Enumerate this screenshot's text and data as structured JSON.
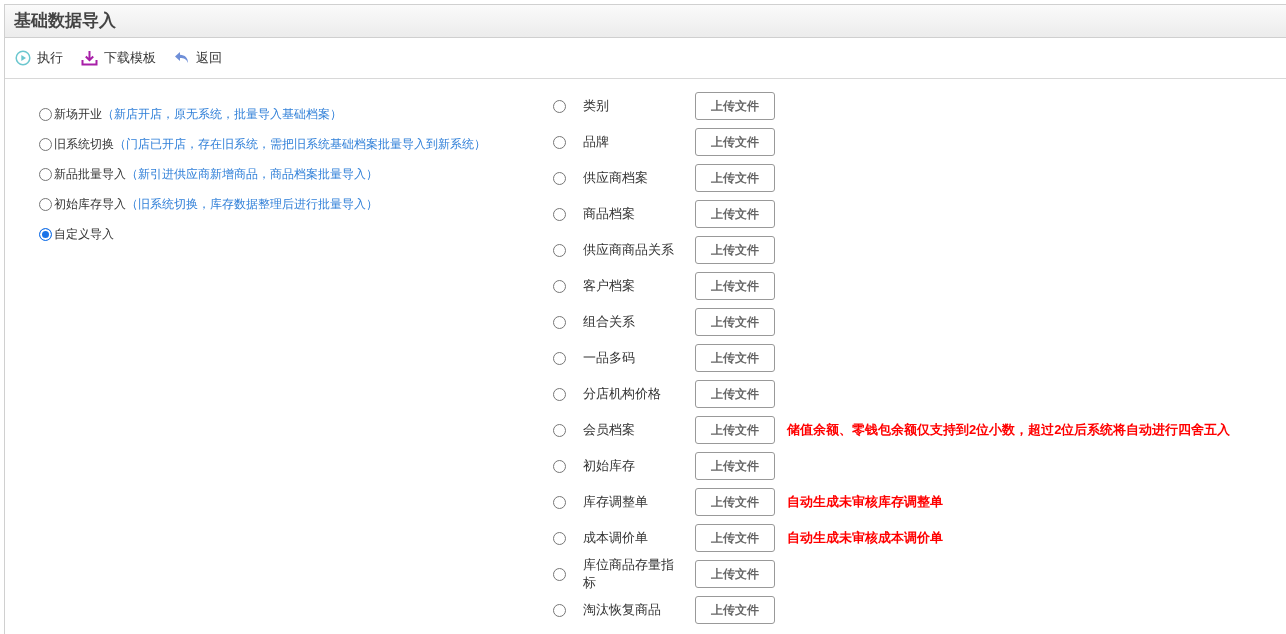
{
  "title": "基础数据导入",
  "toolbar": [
    {
      "kind": "play",
      "label": "执行"
    },
    {
      "kind": "download",
      "label": "下载模板"
    },
    {
      "kind": "back",
      "label": "返回"
    }
  ],
  "modes": [
    {
      "label": "新场开业",
      "note": "（新店开店，原无系统，批量导入基础档案）",
      "selected": false
    },
    {
      "label": "旧系统切换",
      "note": "（门店已开店，存在旧系统，需把旧系统基础档案批量导入到新系统）",
      "selected": false
    },
    {
      "label": "新品批量导入",
      "note": "（新引进供应商新增商品，商品档案批量导入）",
      "selected": false
    },
    {
      "label": "初始库存导入",
      "note": "（旧系统切换，库存数据整理后进行批量导入）",
      "selected": false
    },
    {
      "label": "自定义导入",
      "selected": true
    }
  ],
  "import_items": [
    {
      "label": "类别",
      "selected": false,
      "button": "上传文件"
    },
    {
      "label": "品牌",
      "selected": false,
      "button": "上传文件"
    },
    {
      "label": "供应商档案",
      "selected": false,
      "button": "上传文件"
    },
    {
      "label": "商品档案",
      "selected": false,
      "button": "上传文件"
    },
    {
      "label": "供应商商品关系",
      "selected": false,
      "button": "上传文件"
    },
    {
      "label": "客户档案",
      "selected": false,
      "button": "上传文件"
    },
    {
      "label": "组合关系",
      "selected": false,
      "button": "上传文件"
    },
    {
      "label": "一品多码",
      "selected": false,
      "button": "上传文件"
    },
    {
      "label": "分店机构价格",
      "selected": false,
      "button": "上传文件"
    },
    {
      "label": "会员档案",
      "selected": false,
      "button": "上传文件",
      "note": "储值余额、零钱包余额仅支持到2位小数，超过2位后系统将自动进行四舍五入"
    },
    {
      "label": "初始库存",
      "selected": false,
      "button": "上传文件"
    },
    {
      "label": "库存调整单",
      "selected": false,
      "button": "上传文件",
      "note": "自动生成未审核库存调整单"
    },
    {
      "label": "成本调价单",
      "selected": false,
      "button": "上传文件",
      "note": "自动生成未审核成本调价单"
    },
    {
      "label": "库位商品存量指标",
      "selected": false,
      "button": "上传文件"
    },
    {
      "label": "淘汰恢复商品",
      "selected": false,
      "button": "上传文件"
    }
  ]
}
